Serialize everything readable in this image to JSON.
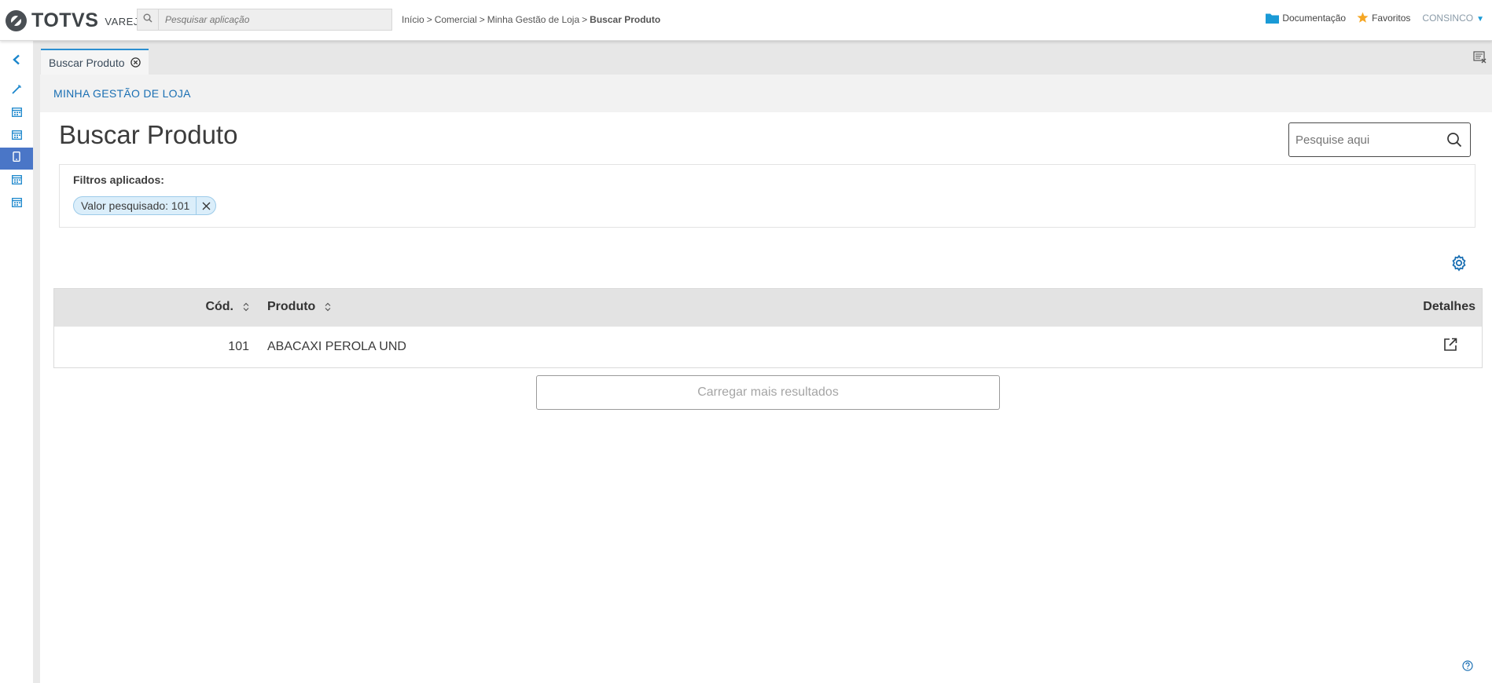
{
  "app": {
    "brand": "TOTVS",
    "product": "VAREJO",
    "search_placeholder": "Pesquisar aplicação"
  },
  "breadcrumb": {
    "items": [
      "Início",
      "Comercial",
      "Minha Gestão de Loja"
    ],
    "current": "Buscar Produto",
    "separator": ">"
  },
  "topnav": {
    "documentation": "Documentação",
    "favorites": "Favoritos",
    "user": "CONSINCO"
  },
  "sidebar": {
    "items": [
      {
        "icon": "chevron-left-icon"
      },
      {
        "icon": "wand-icon"
      },
      {
        "icon": "calendar-icon"
      },
      {
        "icon": "calendar-icon"
      },
      {
        "icon": "mobile-icon",
        "active": true
      },
      {
        "icon": "calendar-icon"
      },
      {
        "icon": "calendar-icon"
      }
    ]
  },
  "tabs": [
    {
      "label": "Buscar Produto",
      "active": true
    }
  ],
  "module": {
    "title": "MINHA GESTÃO DE LOJA"
  },
  "page": {
    "title": "Buscar Produto",
    "quick_search_placeholder": "Pesquise aqui"
  },
  "filters": {
    "label": "Filtros aplicados:",
    "chips": [
      {
        "label": "Valor pesquisado: 101"
      }
    ]
  },
  "table": {
    "columns": [
      "Cód.",
      "Produto",
      "Detalhes"
    ],
    "rows": [
      {
        "cod": "101",
        "produto": "ABACAXI PEROLA UND"
      }
    ]
  },
  "load_more_label": "Carregar mais resultados",
  "colors": {
    "accent": "#2b8fd1",
    "module_title": "#1a6fb3",
    "active_sidebar": "#4a76c7",
    "chip_bg": "#dbeefa",
    "favorites_star": "#f5a623"
  }
}
